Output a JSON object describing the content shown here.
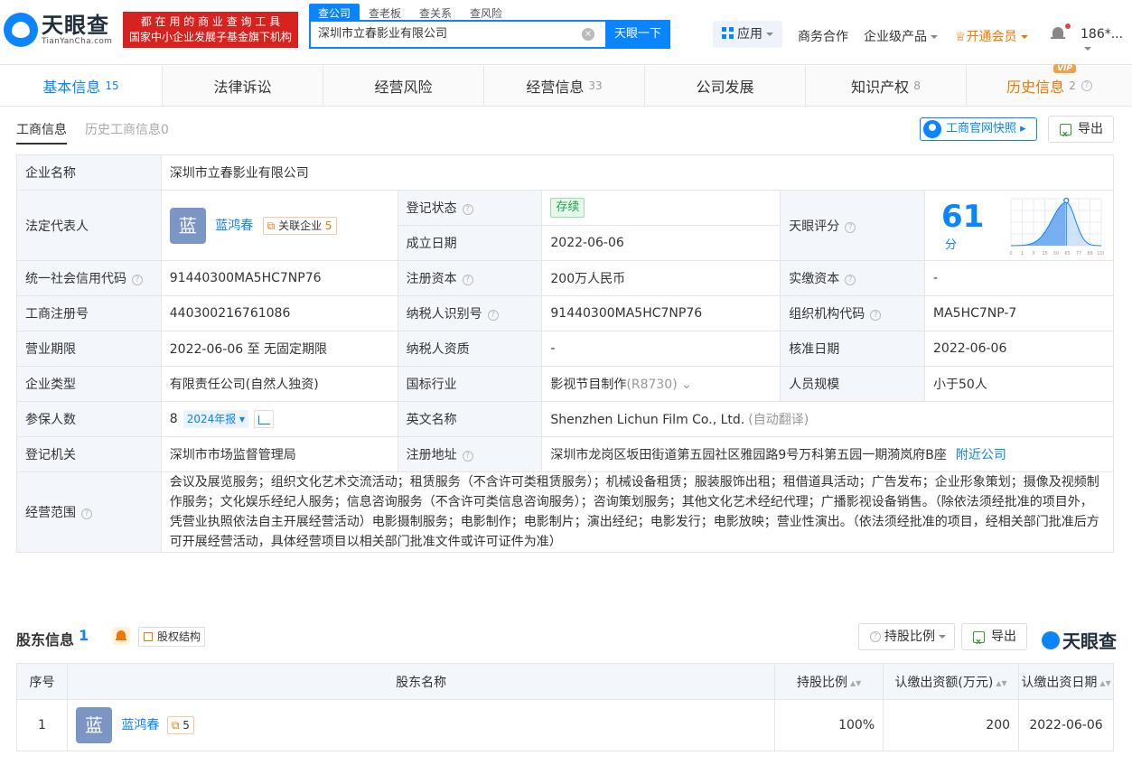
{
  "header": {
    "logo_cn": "天眼查",
    "logo_en": "TianYanCha.com",
    "slogan_line1": "都 在 用 的 商 业 查 询 工 具",
    "slogan_line2": "国家中小企业发展子基金旗下机构",
    "search_tabs": [
      "查公司",
      "查老板",
      "查关系",
      "查风险"
    ],
    "search_value": "深圳市立春影业有限公司",
    "search_button": "天眼一下",
    "nav": {
      "app": "应用",
      "business": "商务合作",
      "enterprise": "企业级产品",
      "vip": "开通会员",
      "user": "186*..."
    }
  },
  "main_tabs": [
    {
      "label": "基本信息",
      "count": "15"
    },
    {
      "label": "法律诉讼",
      "count": ""
    },
    {
      "label": "经营风险",
      "count": ""
    },
    {
      "label": "经营信息",
      "count": "33"
    },
    {
      "label": "公司发展",
      "count": ""
    },
    {
      "label": "知识产权",
      "count": "8"
    },
    {
      "label": "历史信息",
      "count": "2",
      "vip": "VIP"
    }
  ],
  "sub_tabs": {
    "active": "工商信息",
    "inactive": "历史工商信息0"
  },
  "actions": {
    "snapshot": "工商官网快照",
    "export": "导出"
  },
  "info": {
    "company_name_label": "企业名称",
    "company_name": "深圳市立春影业有限公司",
    "legal_rep_label": "法定代表人",
    "legal_rep_avatar": "蓝",
    "legal_rep": "蓝鸿春",
    "related_label": "关联企业",
    "related_count": "5",
    "reg_status_label": "登记状态",
    "reg_status": "存续",
    "found_date_label": "成立日期",
    "found_date": "2022-06-06",
    "score_label": "天眼评分",
    "score": "61",
    "score_unit": "分",
    "credit_code_label": "统一社会信用代码",
    "credit_code": "91440300MA5HC7NP76",
    "reg_capital_label": "注册资本",
    "reg_capital": "200万人民币",
    "paid_capital_label": "实缴资本",
    "paid_capital": "-",
    "reg_no_label": "工商注册号",
    "reg_no": "440300216761086",
    "tax_id_label": "纳税人识别号",
    "tax_id": "91440300MA5HC7NP76",
    "org_code_label": "组织机构代码",
    "org_code": "MA5HC7NP-7",
    "term_label": "营业期限",
    "term": "2022-06-06 至 无固定期限",
    "tax_qual_label": "纳税人资质",
    "tax_qual": "-",
    "approve_date_label": "核准日期",
    "approve_date": "2022-06-06",
    "type_label": "企业类型",
    "type": "有限责任公司(自然人独资)",
    "industry_label": "国标行业",
    "industry": "影视节目制作",
    "industry_code": "(R8730)",
    "staff_label": "人员规模",
    "staff": "小于50人",
    "insured_label": "参保人数",
    "insured": "8",
    "insured_report": "2024年报",
    "en_name_label": "英文名称",
    "en_name": "Shenzhen Lichun Film Co., Ltd.",
    "en_name_note": "(自动翻译)",
    "authority_label": "登记机关",
    "authority": "深圳市市场监督管理局",
    "address_label": "注册地址",
    "address": "深圳市龙岗区坂田街道第五园社区雅园路9号万科第五园一期漪岚府B座",
    "nearby": "附近公司",
    "scope_label": "经营范围",
    "scope": "会议及展览服务；组织文化艺术交流活动；租赁服务（不含许可类租赁服务）；机械设备租赁；服装服饰出租；租借道具活动；广告发布；企业形象策划；摄像及视频制作服务；文化娱乐经纪人服务；信息咨询服务（不含许可类信息咨询服务）；咨询策划服务；其他文化艺术经纪代理；广播影视设备销售。（除依法须经批准的项目外，凭营业执照依法自主开展经营活动）电影摄制服务；电影制作；电影制片；演出经纪；电影发行；电影放映；营业性演出。（依法须经批准的项目，经相关部门批准后方可开展经营活动，具体经营项目以相关部门批准文件或许可证件为准）"
  },
  "score_chart": {
    "ticks": [
      "0",
      "1",
      "3",
      "15",
      "50",
      "65",
      "77",
      "89",
      "100"
    ],
    "marker_value": 61
  },
  "shareholders": {
    "title": "股东信息",
    "count": "1",
    "equity_btn": "股权结构",
    "ratio_btn": "持股比例",
    "export": "导出",
    "brand": "天眼查",
    "headers": [
      "序号",
      "股东名称",
      "持股比例",
      "认缴出资额(万元)",
      "认缴出资日期"
    ],
    "rows": [
      {
        "no": "1",
        "avatar": "蓝",
        "name": "蓝鸿春",
        "related": "5",
        "ratio": "100%",
        "amount": "200",
        "date": "2022-06-06"
      }
    ]
  }
}
